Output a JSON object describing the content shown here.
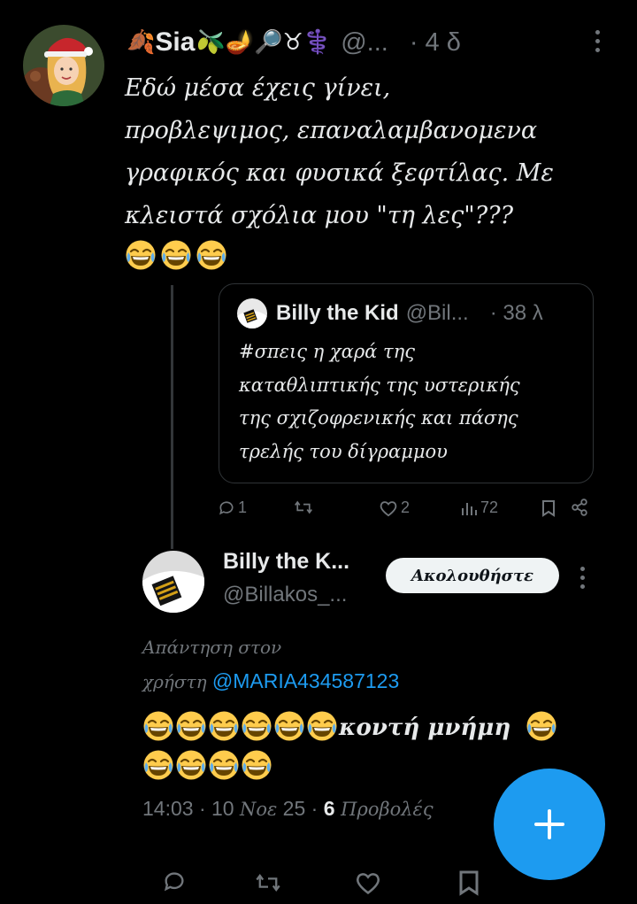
{
  "main_tweet": {
    "author_name": "Sia",
    "name_emojis": "🫒🪔🔎♉⚕️",
    "leaf_emoji": "🍂",
    "handle": "@...",
    "time": "· 4 δ",
    "text_lines": [
      "Εδώ μέσα έχεις γίνει,",
      "προβλεψιμος, επαναλαμβανομενα",
      "γραφικός και φυσικά ξεφτίλας. Με",
      "κλειστά σχόλια μου \"τη λες\"???"
    ],
    "laugh_count": 3
  },
  "quoted_tweet": {
    "author_name": "Billy the Kid",
    "handle": "@Bil...",
    "time": "· 38 λ",
    "text_lines": [
      "#σπεις η χαρά της",
      "καταθλιπτικής της υστερικής",
      "της σχιζοφρενικής και πάσης",
      "τρελής του δίγραμμου"
    ]
  },
  "main_actions": {
    "reply_count": "1",
    "retweet_count": "",
    "like_count": "2",
    "view_count": "72"
  },
  "reply_tweet": {
    "author_name": "Billy the K...",
    "handle": "@Billakos_...",
    "follow_label": "Ακολουθήστε",
    "reply_to_prefix_1": "Απάντηση στον",
    "reply_to_prefix_2": "χρήστη",
    "reply_to_mention": "@MARIA434587123",
    "text_core": "κοντή μνήμη",
    "timestamp": "14:03 · 10 ",
    "month": "Νοε",
    "year_dot": " 25 · ",
    "views_number": "6",
    "views_label": " Προβολές"
  },
  "colors": {
    "background": "#000000",
    "text": "#e7e9ea",
    "muted": "#71767b",
    "accent": "#1d9bf0",
    "border": "#2f3336"
  },
  "icons": {
    "compose_fab": "plus-icon",
    "reply": "speech-bubble-icon",
    "retweet": "retweet-icon",
    "like": "heart-icon",
    "views": "bar-chart-icon",
    "bookmark": "bookmark-icon",
    "share": "share-icon"
  }
}
